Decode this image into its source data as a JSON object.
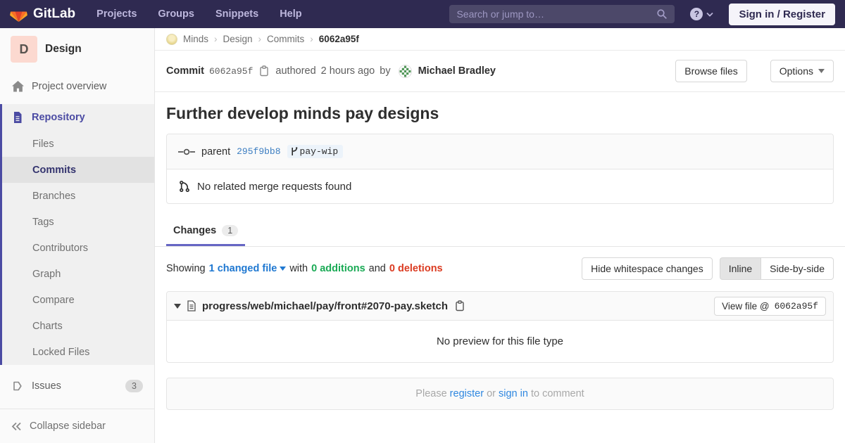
{
  "navbar": {
    "brand": "GitLab",
    "links": [
      "Projects",
      "Groups",
      "Snippets",
      "Help"
    ],
    "search_placeholder": "Search or jump to…",
    "help_glyph": "?",
    "signin_label": "Sign in / Register"
  },
  "sidebar": {
    "project_initial": "D",
    "project_name": "Design",
    "overview_label": "Project overview",
    "repository_label": "Repository",
    "repo_items": [
      "Files",
      "Commits",
      "Branches",
      "Tags",
      "Contributors",
      "Graph",
      "Compare",
      "Charts",
      "Locked Files"
    ],
    "active_repo_item": "Commits",
    "issues_label": "Issues",
    "issues_count": "3",
    "collapse_label": "Collapse sidebar"
  },
  "breadcrumb": {
    "items": [
      "Minds",
      "Design",
      "Commits"
    ],
    "current": "6062a95f",
    "separator": "›"
  },
  "commit": {
    "label": "Commit",
    "sha_short": "6062a95f",
    "authored_text": "authored",
    "time_ago": "2 hours ago",
    "by_text": "by",
    "author_name": "Michael Bradley",
    "browse_files_label": "Browse files",
    "options_label": "Options",
    "title": "Further develop minds pay designs",
    "parent_label": "parent",
    "parent_sha": "295f9bb8",
    "ref_name": "pay-wip",
    "no_mr_text": "No related merge requests found"
  },
  "tabs": {
    "changes_label": "Changes",
    "changes_count": "1"
  },
  "diff": {
    "showing_prefix": "Showing",
    "changed_file_label": "1 changed file",
    "with_text": "with",
    "additions_label": "0 additions",
    "and_text": "and",
    "deletions_label": "0 deletions",
    "hide_whitespace_label": "Hide whitespace changes",
    "inline_label": "Inline",
    "side_by_side_label": "Side-by-side",
    "file_path": "progress/web/michael/pay/front#2070-pay.sketch",
    "view_file_label": "View file @",
    "view_file_sha": "6062a95f",
    "no_preview_text": "No preview for this file type"
  },
  "comment": {
    "please_text": "Please",
    "register_label": "register",
    "or_text": "or",
    "signin_label": "sign in",
    "to_comment_text": "to comment"
  },
  "colors": {
    "navbar_bg": "#2f2a51",
    "sidebar_active_accent": "#4b4ba3",
    "tab_underline": "#6666c4",
    "link_blue": "#1f78d1",
    "sha_blue": "#3b7dc1",
    "additions_green": "#1aaa55",
    "deletions_red": "#db3b21",
    "project_avatar_bg": "#fcd9d0"
  }
}
